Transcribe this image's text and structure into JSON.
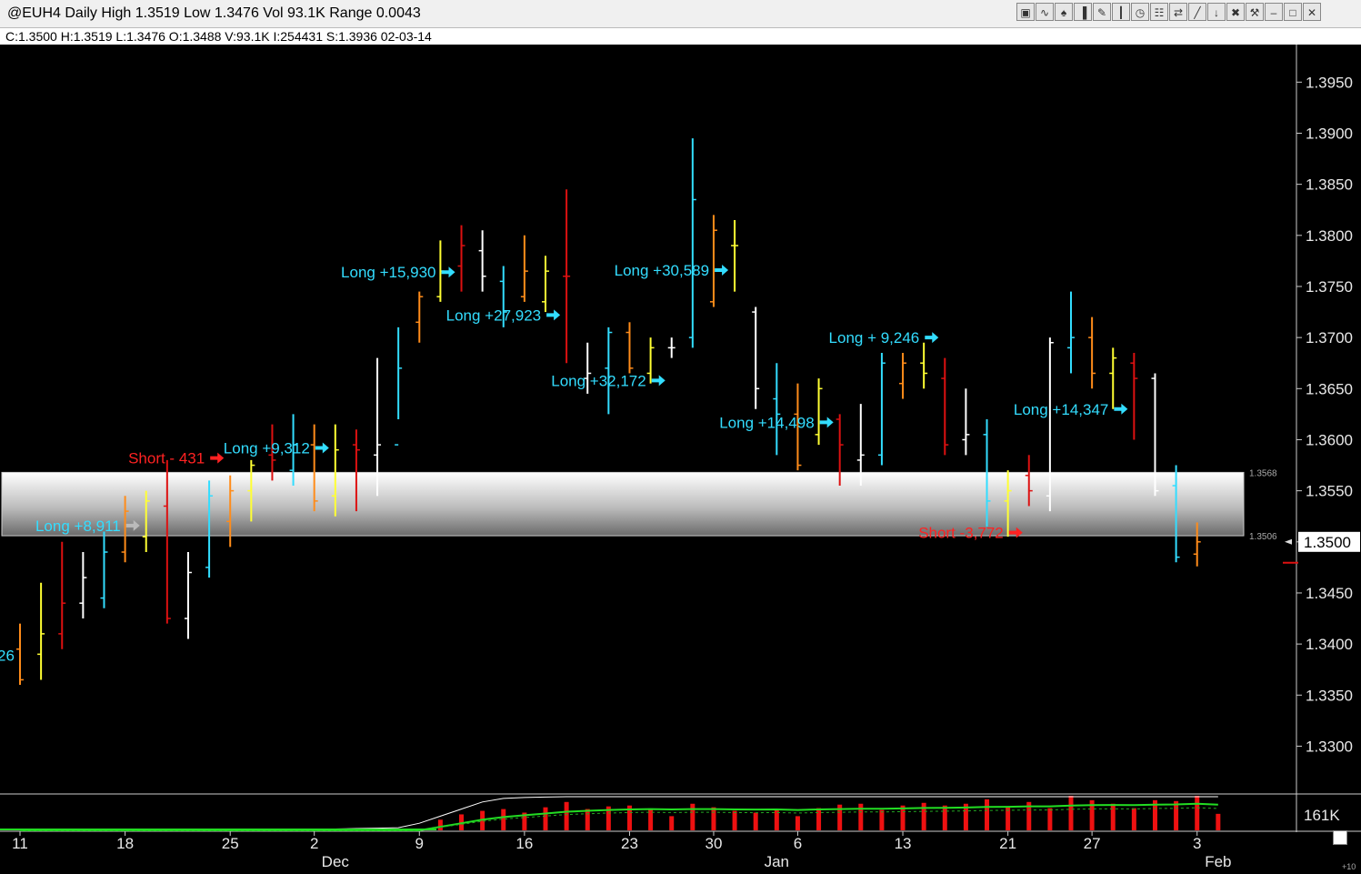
{
  "window": {
    "title": "@EUH4 Daily High 1.3519 Low 1.3476 Vol 93.1K Range 0.0043",
    "info": "C:1.3500  H:1.3519  L:1.3476  O:1.3488  V:93.1K  I:254431  S:1.3936  02-03-14",
    "toolbar_icons": [
      "chart-icon",
      "waves-icon",
      "tree-icon",
      "bars-icon",
      "pencil-icon",
      "candle-icon",
      "clock-icon",
      "page-icon",
      "arrows-icon",
      "line-icon",
      "red-arrow-icon",
      "trash-icon",
      "tools-icon",
      "minimize-icon",
      "restore-icon",
      "close-icon"
    ]
  },
  "chart_data": {
    "type": "ohlc",
    "symbol": "@EUH4",
    "ylim": [
      1.3255,
      1.3985
    ],
    "y_ticks": [
      "1.3950",
      "1.3900",
      "1.3850",
      "1.3800",
      "1.3750",
      "1.3700",
      "1.3650",
      "1.3600",
      "1.3550",
      "1.3500",
      "1.3450",
      "1.3400",
      "1.3350",
      "1.3300"
    ],
    "last_price_label": "1.3500",
    "band": {
      "upper": 1.3568,
      "lower": 1.3506,
      "upper_label": "1.3568",
      "lower_label": "1.3506"
    },
    "x_day_labels": [
      {
        "label": "11",
        "bar": 0
      },
      {
        "label": "18",
        "bar": 5
      },
      {
        "label": "25",
        "bar": 10
      },
      {
        "label": "2",
        "bar": 14
      },
      {
        "label": "9",
        "bar": 19
      },
      {
        "label": "16",
        "bar": 24
      },
      {
        "label": "23",
        "bar": 29
      },
      {
        "label": "30",
        "bar": 33
      },
      {
        "label": "6",
        "bar": 37
      },
      {
        "label": "13",
        "bar": 42
      },
      {
        "label": "21",
        "bar": 47
      },
      {
        "label": "27",
        "bar": 51
      },
      {
        "label": "3",
        "bar": 56
      }
    ],
    "x_month_labels": [
      {
        "label": "Dec",
        "bar": 15
      },
      {
        "label": "Jan",
        "bar": 36
      },
      {
        "label": "Feb",
        "bar": 57
      }
    ],
    "bars": [
      {
        "h": 1.342,
        "l": 1.336,
        "o": 1.3395,
        "c": 1.3365,
        "color": "#ff8c1a"
      },
      {
        "h": 1.346,
        "l": 1.3365,
        "o": 1.339,
        "c": 1.341,
        "color": "#ffff33"
      },
      {
        "h": 1.35,
        "l": 1.3395,
        "o": 1.341,
        "c": 1.344,
        "color": "#dd1111"
      },
      {
        "h": 1.349,
        "l": 1.3425,
        "o": 1.344,
        "c": 1.3465,
        "color": "#ffffff"
      },
      {
        "h": 1.351,
        "l": 1.3435,
        "o": 1.3445,
        "c": 1.349,
        "color": "#33ddff"
      },
      {
        "h": 1.3545,
        "l": 1.348,
        "o": 1.349,
        "c": 1.353,
        "color": "#ff8c1a"
      },
      {
        "h": 1.355,
        "l": 1.349,
        "o": 1.3505,
        "c": 1.354,
        "color": "#ffff33"
      },
      {
        "h": 1.358,
        "l": 1.342,
        "o": 1.3535,
        "c": 1.3425,
        "color": "#dd1111"
      },
      {
        "h": 1.349,
        "l": 1.3405,
        "o": 1.3425,
        "c": 1.347,
        "color": "#ffffff"
      },
      {
        "h": 1.356,
        "l": 1.3465,
        "o": 1.3475,
        "c": 1.3545,
        "color": "#33ddff"
      },
      {
        "h": 1.3565,
        "l": 1.3495,
        "o": 1.352,
        "c": 1.355,
        "color": "#ff8c1a"
      },
      {
        "h": 1.358,
        "l": 1.352,
        "o": 1.355,
        "c": 1.3575,
        "color": "#ffff33"
      },
      {
        "h": 1.3615,
        "l": 1.356,
        "o": 1.3585,
        "c": 1.358,
        "color": "#dd1111"
      },
      {
        "h": 1.3625,
        "l": 1.3555,
        "o": 1.357,
        "c": 1.3595,
        "color": "#33ddff"
      },
      {
        "h": 1.3615,
        "l": 1.353,
        "o": 1.3595,
        "c": 1.354,
        "color": "#ff8c1a"
      },
      {
        "h": 1.3615,
        "l": 1.3525,
        "o": 1.3545,
        "c": 1.359,
        "color": "#ffff33"
      },
      {
        "h": 1.361,
        "l": 1.353,
        "o": 1.3595,
        "c": 1.359,
        "color": "#dd1111"
      },
      {
        "h": 1.368,
        "l": 1.3545,
        "o": 1.3585,
        "c": 1.3595,
        "color": "#ffffff"
      },
      {
        "h": 1.371,
        "l": 1.362,
        "o": 1.3595,
        "c": 1.367,
        "color": "#33ddff"
      },
      {
        "h": 1.3745,
        "l": 1.3695,
        "o": 1.3715,
        "c": 1.374,
        "color": "#ff8c1a"
      },
      {
        "h": 1.3795,
        "l": 1.3735,
        "o": 1.374,
        "c": 1.3765,
        "color": "#ffff33"
      },
      {
        "h": 1.381,
        "l": 1.3745,
        "o": 1.377,
        "c": 1.379,
        "color": "#dd1111"
      },
      {
        "h": 1.3805,
        "l": 1.3745,
        "o": 1.3785,
        "c": 1.376,
        "color": "#ffffff"
      },
      {
        "h": 1.377,
        "l": 1.371,
        "o": 1.3755,
        "c": 1.3725,
        "color": "#33ddff"
      },
      {
        "h": 1.38,
        "l": 1.3735,
        "o": 1.374,
        "c": 1.3765,
        "color": "#ff8c1a"
      },
      {
        "h": 1.378,
        "l": 1.3725,
        "o": 1.3735,
        "c": 1.3765,
        "color": "#ffff33"
      },
      {
        "h": 1.3845,
        "l": 1.3675,
        "o": 1.376,
        "c": 1.376,
        "color": "#dd1111"
      },
      {
        "h": 1.3695,
        "l": 1.3645,
        "o": 1.366,
        "c": 1.3665,
        "color": "#ffffff"
      },
      {
        "h": 1.371,
        "l": 1.3625,
        "o": 1.367,
        "c": 1.3705,
        "color": "#33ddff"
      },
      {
        "h": 1.3715,
        "l": 1.3665,
        "o": 1.3705,
        "c": 1.367,
        "color": "#ff8c1a"
      },
      {
        "h": 1.37,
        "l": 1.3655,
        "o": 1.3665,
        "c": 1.369,
        "color": "#ffff33"
      },
      {
        "h": 1.37,
        "l": 1.368,
        "o": 1.369,
        "c": 1.369,
        "color": "#ffffff"
      },
      {
        "h": 1.3895,
        "l": 1.369,
        "o": 1.37,
        "c": 1.3835,
        "color": "#33ddff"
      },
      {
        "h": 1.382,
        "l": 1.373,
        "o": 1.3735,
        "c": 1.3805,
        "color": "#ff8c1a"
      },
      {
        "h": 1.3815,
        "l": 1.3745,
        "o": 1.379,
        "c": 1.379,
        "color": "#ffff33"
      },
      {
        "h": 1.373,
        "l": 1.363,
        "o": 1.3725,
        "c": 1.365,
        "color": "#ffffff"
      },
      {
        "h": 1.3675,
        "l": 1.3585,
        "o": 1.364,
        "c": 1.3625,
        "color": "#33ddff"
      },
      {
        "h": 1.3655,
        "l": 1.357,
        "o": 1.3625,
        "c": 1.3575,
        "color": "#ff8c1a"
      },
      {
        "h": 1.366,
        "l": 1.3595,
        "o": 1.3605,
        "c": 1.365,
        "color": "#ffff33"
      },
      {
        "h": 1.3625,
        "l": 1.3555,
        "o": 1.362,
        "c": 1.3595,
        "color": "#dd1111"
      },
      {
        "h": 1.3635,
        "l": 1.3555,
        "o": 1.358,
        "c": 1.3585,
        "color": "#ffffff"
      },
      {
        "h": 1.3685,
        "l": 1.3575,
        "o": 1.3585,
        "c": 1.3675,
        "color": "#33ddff"
      },
      {
        "h": 1.3685,
        "l": 1.364,
        "o": 1.3655,
        "c": 1.3675,
        "color": "#ff8c1a"
      },
      {
        "h": 1.3695,
        "l": 1.365,
        "o": 1.3675,
        "c": 1.3665,
        "color": "#ffff33"
      },
      {
        "h": 1.368,
        "l": 1.3585,
        "o": 1.366,
        "c": 1.3595,
        "color": "#dd1111"
      },
      {
        "h": 1.365,
        "l": 1.3585,
        "o": 1.36,
        "c": 1.3605,
        "color": "#ffffff"
      },
      {
        "h": 1.362,
        "l": 1.3515,
        "o": 1.3605,
        "c": 1.354,
        "color": "#33ddff"
      },
      {
        "h": 1.357,
        "l": 1.3505,
        "o": 1.354,
        "c": 1.355,
        "color": "#ffff33"
      },
      {
        "h": 1.3585,
        "l": 1.3535,
        "o": 1.3565,
        "c": 1.355,
        "color": "#dd1111"
      },
      {
        "h": 1.37,
        "l": 1.353,
        "o": 1.3545,
        "c": 1.3695,
        "color": "#ffffff"
      },
      {
        "h": 1.3745,
        "l": 1.3665,
        "o": 1.369,
        "c": 1.37,
        "color": "#33ddff"
      },
      {
        "h": 1.372,
        "l": 1.365,
        "o": 1.37,
        "c": 1.3665,
        "color": "#ff8c1a"
      },
      {
        "h": 1.369,
        "l": 1.363,
        "o": 1.3665,
        "c": 1.368,
        "color": "#ffff33"
      },
      {
        "h": 1.3685,
        "l": 1.36,
        "o": 1.3675,
        "c": 1.366,
        "color": "#dd1111"
      },
      {
        "h": 1.3665,
        "l": 1.3545,
        "o": 1.366,
        "c": 1.355,
        "color": "#ffffff"
      },
      {
        "h": 1.3575,
        "l": 1.348,
        "o": 1.3555,
        "c": 1.3485,
        "color": "#33ddff"
      },
      {
        "h": 1.3519,
        "l": 1.3476,
        "o": 1.3488,
        "c": 1.35,
        "color": "#ff8c1a"
      }
    ],
    "annotations": [
      {
        "text": "Long +8,911",
        "bar": 6,
        "price": 1.3516,
        "color": "#33ddff",
        "arrow": "#bbbbbb"
      },
      {
        "text": "Short - 431",
        "bar": 10,
        "price": 1.3582,
        "color": "#ff2222",
        "arrow": "#ff2222"
      },
      {
        "text": "Long +9,312",
        "bar": 15,
        "price": 1.3592,
        "color": "#33ddff",
        "arrow": "#33ddff"
      },
      {
        "text": "Long +15,930",
        "bar": 21,
        "price": 1.3764,
        "color": "#33ddff",
        "arrow": "#33ddff"
      },
      {
        "text": "Long +27,923",
        "bar": 26,
        "price": 1.3722,
        "color": "#33ddff",
        "arrow": "#33ddff"
      },
      {
        "text": "Long +32,172",
        "bar": 31,
        "price": 1.3658,
        "color": "#33ddff",
        "arrow": "#33ddff"
      },
      {
        "text": "Long +30,589",
        "bar": 34,
        "price": 1.3766,
        "color": "#33ddff",
        "arrow": "#33ddff"
      },
      {
        "text": "Long + 9,246",
        "bar": 44,
        "price": 1.37,
        "color": "#33ddff",
        "arrow": "#33ddff"
      },
      {
        "text": "Long +14,498",
        "bar": 39,
        "price": 1.3617,
        "color": "#33ddff",
        "arrow": "#33ddff"
      },
      {
        "text": "Long +14,347",
        "bar": 53,
        "price": 1.363,
        "color": "#33ddff",
        "arrow": "#33ddff"
      },
      {
        "text": "Short -3,772",
        "bar": 48,
        "price": 1.3509,
        "color": "#ff2222",
        "arrow": "#ff2222"
      },
      {
        "text": "26",
        "bar": 0,
        "price": 1.3389,
        "color": "#33ddff",
        "arrow": "",
        "left_clip": true
      }
    ],
    "volume": {
      "label": "161K",
      "max": 200000,
      "bars": [
        0,
        0,
        0,
        0,
        0,
        0,
        0,
        0,
        0,
        0,
        0,
        0,
        0,
        0,
        0,
        0,
        0,
        0,
        0,
        0,
        60000,
        90000,
        110000,
        120000,
        100000,
        130000,
        160000,
        120000,
        135000,
        140000,
        120000,
        80000,
        150000,
        130000,
        110000,
        100000,
        120000,
        80000,
        125000,
        145000,
        150000,
        115000,
        140000,
        155000,
        140000,
        150000,
        175000,
        135000,
        160000,
        125000,
        195000,
        170000,
        150000,
        125000,
        170000,
        165000,
        195000,
        93100
      ],
      "avg": [
        0,
        0,
        0,
        0,
        0,
        0,
        0,
        0,
        0,
        0,
        0,
        0,
        0,
        0,
        0,
        0,
        0,
        0,
        0,
        0,
        20000,
        40000,
        60000,
        75000,
        85000,
        95000,
        105000,
        110000,
        115000,
        118000,
        120000,
        118000,
        120000,
        120000,
        118000,
        117000,
        118000,
        115000,
        118000,
        120000,
        122000,
        122000,
        124000,
        126000,
        127000,
        129000,
        132000,
        133000,
        135000,
        135000,
        140000,
        142000,
        143000,
        142000,
        145000,
        146000,
        150000,
        145000
      ],
      "oi": [
        5000,
        5000,
        5000,
        5000,
        5000,
        5000,
        5000,
        5000,
        5000,
        5000,
        5000,
        5000,
        5000,
        5000,
        6000,
        8000,
        10000,
        12000,
        15000,
        40000,
        80000,
        120000,
        160000,
        180000,
        185000,
        188000,
        190000,
        190000,
        190000,
        190000,
        190000,
        190000,
        190000,
        190000,
        190000,
        190000,
        190000,
        190000,
        190000,
        190000,
        190000,
        190000,
        190000,
        190000,
        190000,
        190000,
        190000,
        190000,
        190000,
        190000,
        190000,
        190000,
        190000,
        190000,
        190000,
        190000,
        190000,
        190000
      ]
    }
  }
}
